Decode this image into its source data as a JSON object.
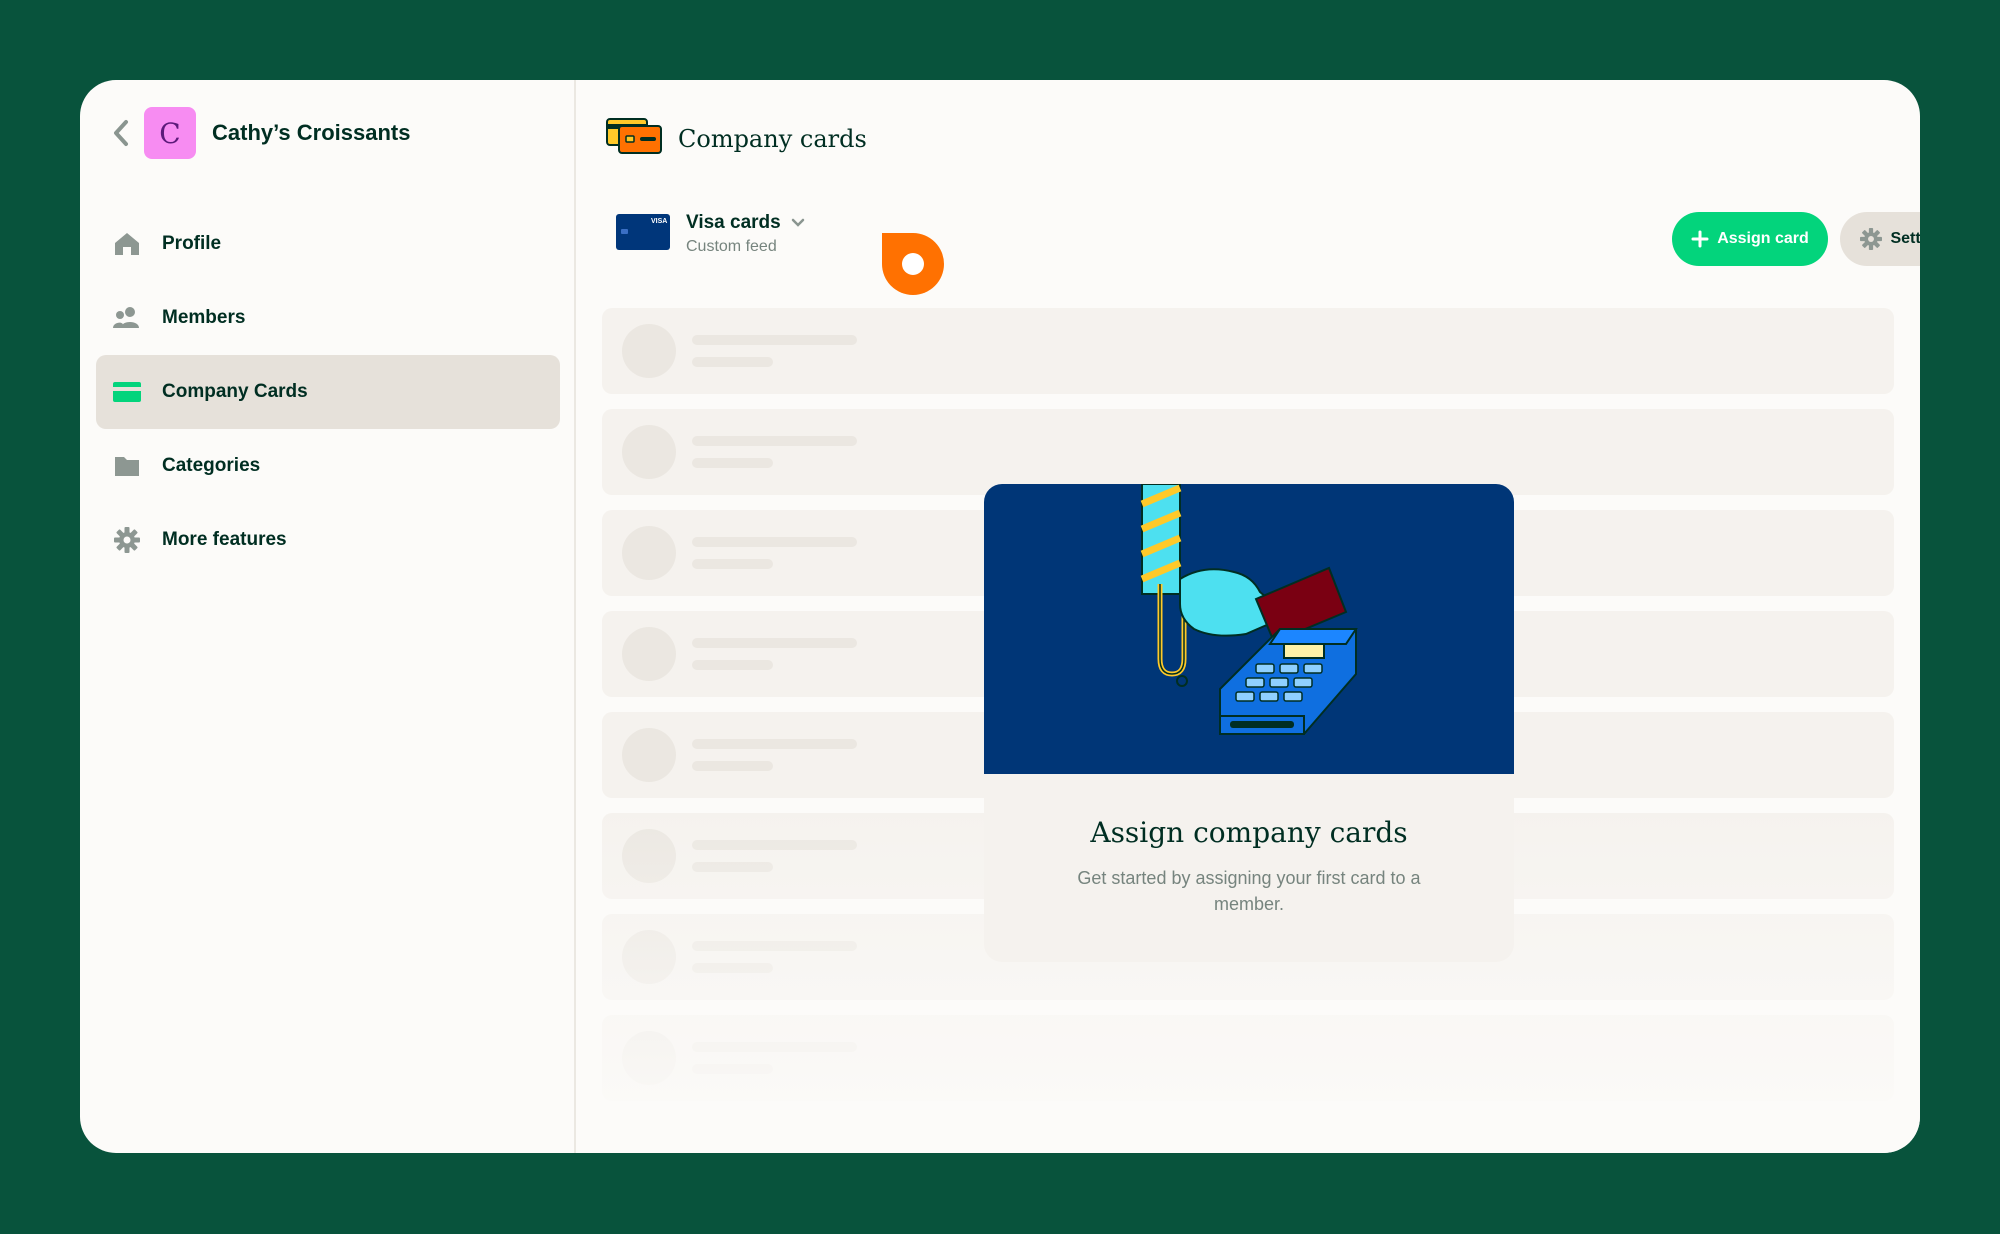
{
  "workspace": {
    "avatar_letter": "C",
    "name": "Cathy’s Croissants"
  },
  "sidebar": {
    "items": [
      {
        "label": "Profile",
        "icon": "home-icon",
        "active": false
      },
      {
        "label": "Members",
        "icon": "users-icon",
        "active": false
      },
      {
        "label": "Company Cards",
        "icon": "credit-card-icon",
        "active": true
      },
      {
        "label": "Categories",
        "icon": "folder-icon",
        "active": false
      },
      {
        "label": "More features",
        "icon": "gear-icon",
        "active": false
      }
    ]
  },
  "main": {
    "title": "Company cards",
    "feed": {
      "name": "Visa cards",
      "subtitle": "Custom feed",
      "card_brand": "VISA"
    },
    "actions": {
      "assign_label": "Assign card",
      "settings_label": "Settings"
    },
    "empty_state": {
      "title": "Assign company cards",
      "subtitle": "Get started by assigning your first card to a member."
    }
  },
  "colors": {
    "background": "#08533c",
    "accent_green": "#03d47c",
    "text_dark": "#002e22",
    "text_muted": "#76847e",
    "avatar_pink": "#f78cf2",
    "cursor_orange": "#ff7101",
    "illustration_blue": "#003677"
  }
}
